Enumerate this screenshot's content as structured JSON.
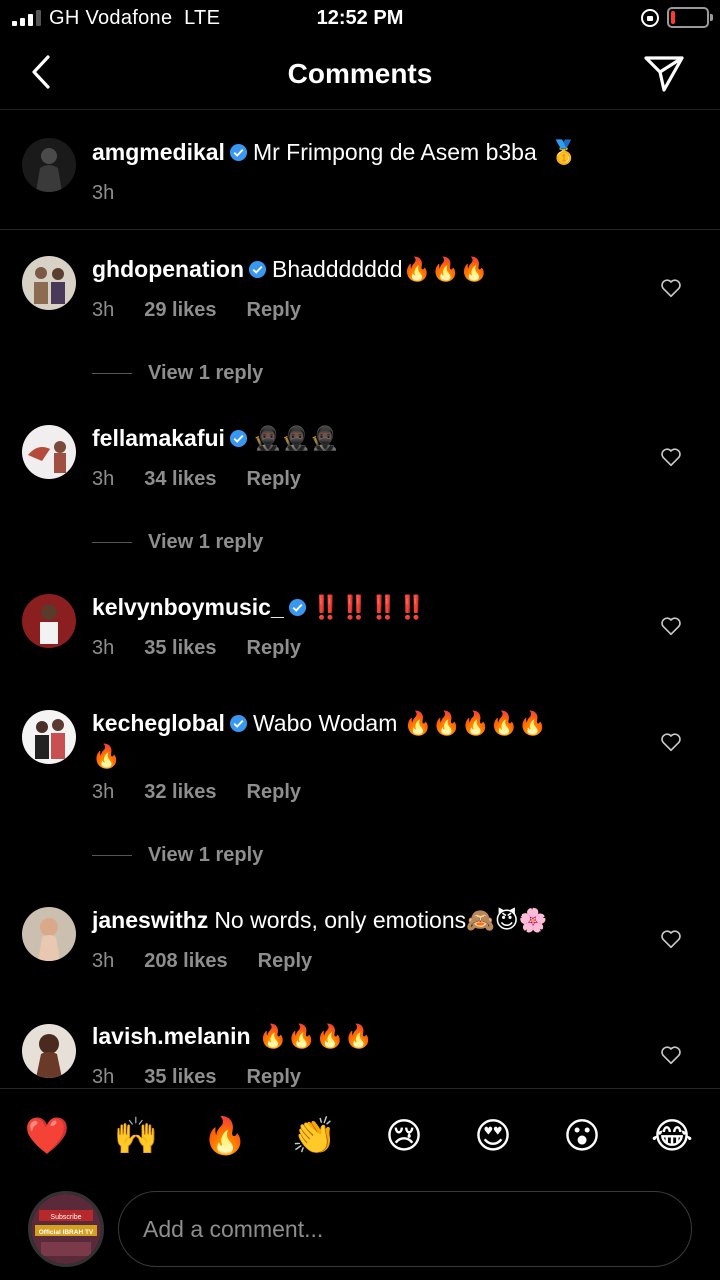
{
  "status_bar": {
    "carrier": "GH Vodafone",
    "network": "LTE",
    "time": "12:52 PM",
    "battery_level": 0.12
  },
  "header": {
    "title": "Comments"
  },
  "caption": {
    "username": "amgmedikal",
    "text": "Mr Frimpong de Asem b3ba",
    "emoji": "🥇",
    "time": "3h"
  },
  "comments": [
    {
      "username": "ghdopenation",
      "text": "Bhaddddddd🔥🔥🔥",
      "time": "3h",
      "likes": "29 likes",
      "reply": "Reply",
      "view_replies": "View 1 reply"
    },
    {
      "username": "fellamakafui",
      "text": "🥷🏿🥷🏿🥷🏿",
      "time": "3h",
      "likes": "34 likes",
      "reply": "Reply",
      "view_replies": "View 1 reply"
    },
    {
      "username": "kelvynboymusic_",
      "text": "‼️‼️‼️‼️",
      "time": "3h",
      "likes": "35 likes",
      "reply": "Reply"
    },
    {
      "username": "kecheglobal",
      "text": "Wabo Wodam 🔥🔥🔥🔥🔥",
      "text2": "🔥",
      "time": "3h",
      "likes": "32 likes",
      "reply": "Reply",
      "view_replies": "View 1 reply"
    },
    {
      "username": "janeswithz",
      "text": "No words, only emotions🙈😈🌸",
      "time": "3h",
      "likes": "208 likes",
      "reply": "Reply"
    },
    {
      "username": "lavish.melanin",
      "text": "🔥🔥🔥🔥",
      "time": "3h",
      "likes": "35 likes",
      "reply": "Reply"
    }
  ],
  "reactions": [
    "❤️",
    "🙌",
    "🔥",
    "👏",
    "😢",
    "😍",
    "😮",
    "😂"
  ],
  "composer": {
    "placeholder": "Add a comment...",
    "avatar_text_top": "Subscribe",
    "avatar_text_bottom": "Official IBRAH TV"
  },
  "colors": {
    "verified": "#3897f0",
    "muted": "#8e8e8e",
    "background": "#000000"
  }
}
